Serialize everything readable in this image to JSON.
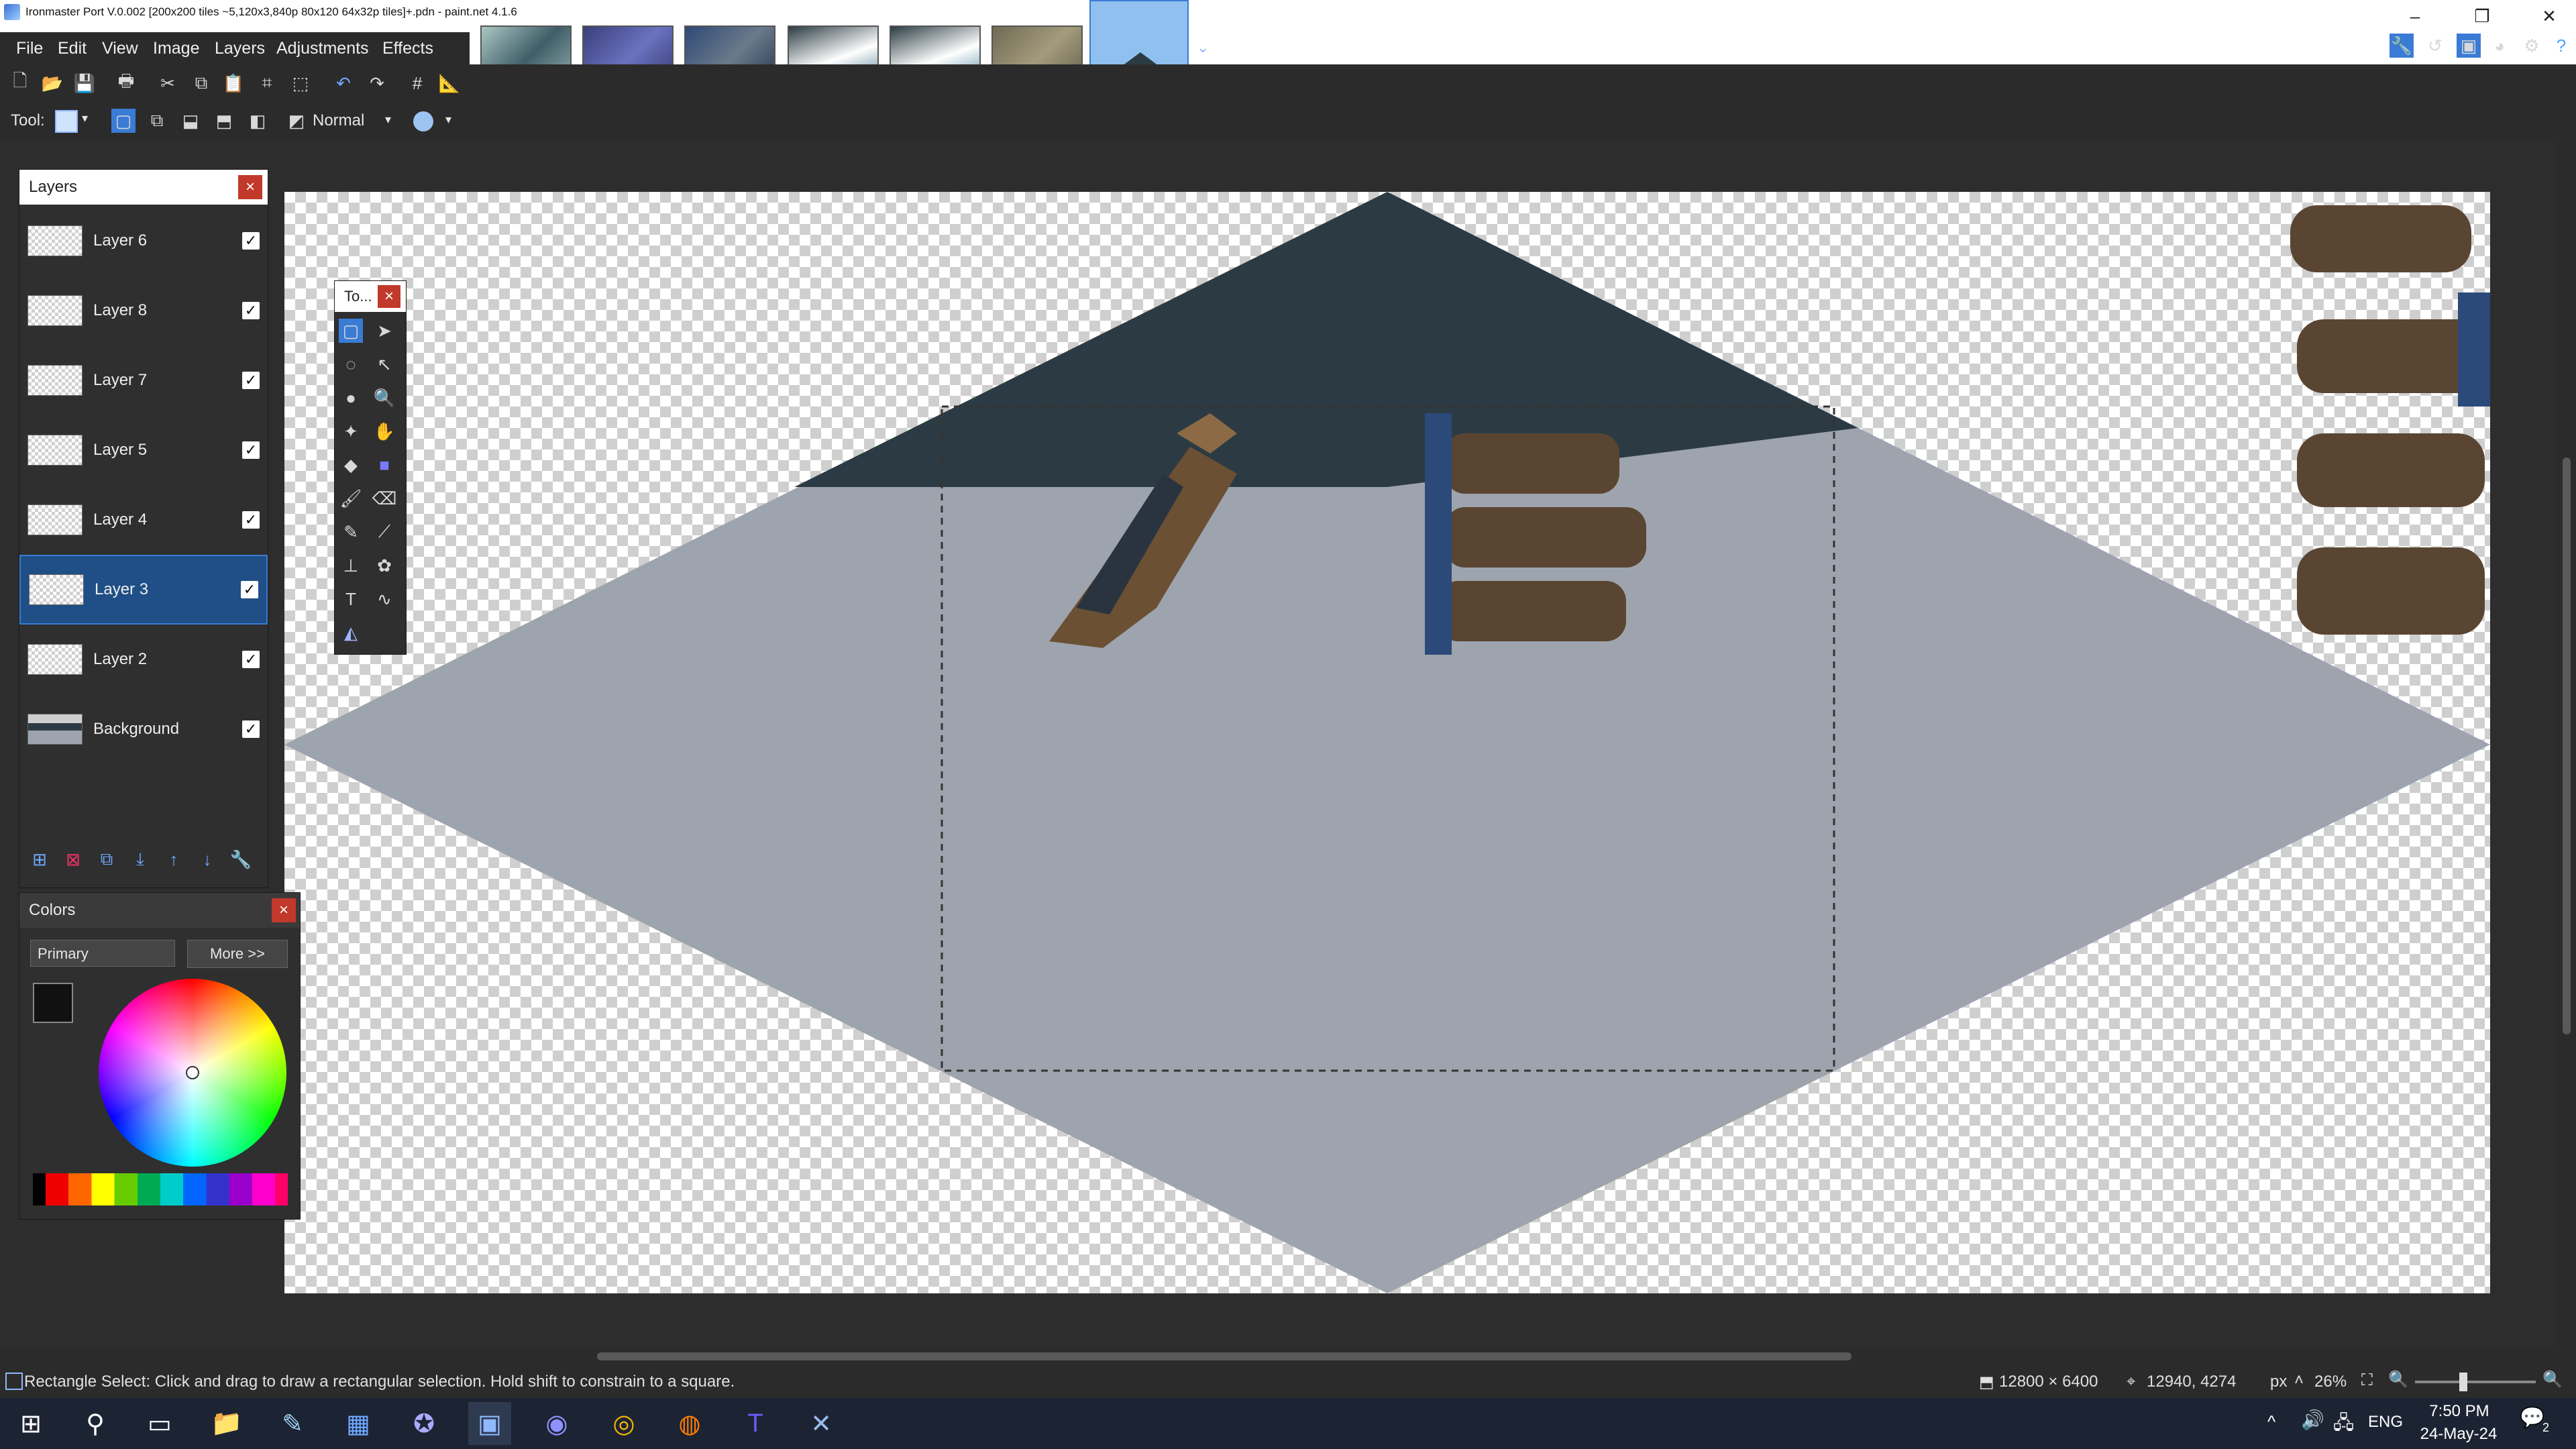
{
  "window": {
    "title": "Ironmaster Port V.0.002 [200x200 tiles ~5,120x3,840p 80x120 64x32p tiles]+.pdn - paint.net 4.1.6",
    "minimize": "–",
    "maximize": "❐",
    "close": "✕"
  },
  "menu": [
    "File",
    "Edit",
    "View",
    "Image",
    "Layers",
    "Adjustments",
    "Effects"
  ],
  "toolbar": {
    "tool_label": "Tool:",
    "blend_mode": "Normal"
  },
  "layers_panel": {
    "title": "Layers",
    "close": "×",
    "layers": [
      {
        "name": "Layer 6",
        "visible": true,
        "selected": false
      },
      {
        "name": "Layer 8",
        "visible": true,
        "selected": false
      },
      {
        "name": "Layer 7",
        "visible": true,
        "selected": false
      },
      {
        "name": "Layer 5",
        "visible": true,
        "selected": false
      },
      {
        "name": "Layer 4",
        "visible": true,
        "selected": false
      },
      {
        "name": "Layer 3",
        "visible": true,
        "selected": true
      },
      {
        "name": "Layer 2",
        "visible": true,
        "selected": false
      },
      {
        "name": "Background",
        "visible": true,
        "selected": false
      }
    ],
    "check_glyph": "✓"
  },
  "tools_panel": {
    "title": "To...",
    "close": "×"
  },
  "colors_panel": {
    "title": "Colors",
    "close": "×",
    "mode_select": "Primary",
    "more_button": "More >>",
    "primary_color": "#111111",
    "secondary_color": "#e8e8e8"
  },
  "status": {
    "hint": "Rectangle Select: Click and drag to draw a rectangular selection. Hold shift to constrain to a square.",
    "image_size": "12800 × 6400",
    "cursor_pos": "12940, 4274",
    "units": "px",
    "zoom": "26%"
  },
  "taskbar": {
    "time": "7:50 PM",
    "date": "24-May-24",
    "lang": "ENG",
    "notifications": "2"
  },
  "colors": {
    "accent": "#3a7bd5",
    "diamond_fill": "#9ea4ad",
    "dark_top": "#2c3b43"
  }
}
